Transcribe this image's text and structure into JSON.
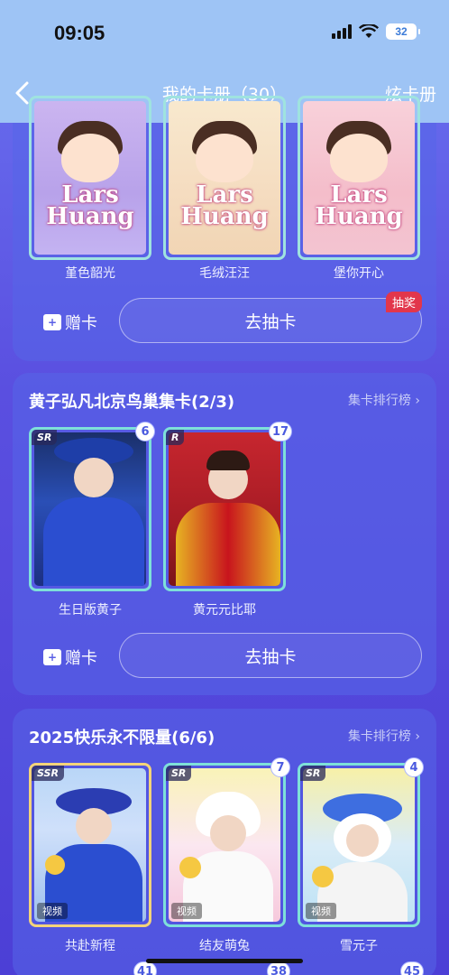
{
  "status": {
    "time": "09:05",
    "battery": "32"
  },
  "nav": {
    "title": "我的卡册（30）",
    "right": "炫卡册"
  },
  "section1": {
    "cards": [
      {
        "name": "堇色韶光",
        "logo": "Lars Huang"
      },
      {
        "name": "毛绒汪汪",
        "logo": "Lars Huang"
      },
      {
        "name": "堡你开心",
        "logo": "Lars Huang"
      }
    ],
    "gift_label": "赠卡",
    "draw_label": "去抽卡",
    "lottery_badge": "抽奖"
  },
  "section2": {
    "title": "黄子弘凡北京鸟巢集卡(2/3)",
    "rank_link": "集卡排行榜",
    "cards": [
      {
        "name": "生日版黄子",
        "tier": "SR",
        "count": "6"
      },
      {
        "name": "黄元元比耶",
        "tier": "R",
        "count": "17"
      }
    ],
    "gift_label": "赠卡",
    "draw_label": "去抽卡"
  },
  "section3": {
    "title": "2025快乐永不限量(6/6)",
    "rank_link": "集卡排行榜",
    "cards": [
      {
        "name": "共赴新程",
        "tier": "SSR",
        "count": "",
        "tag": "视频"
      },
      {
        "name": "结友萌兔",
        "tier": "SR",
        "count": "7",
        "tag": "视频"
      },
      {
        "name": "雪元子",
        "tier": "SR",
        "count": "4",
        "tag": "视频"
      }
    ],
    "peek_counts": [
      "41",
      "38",
      "45"
    ]
  }
}
